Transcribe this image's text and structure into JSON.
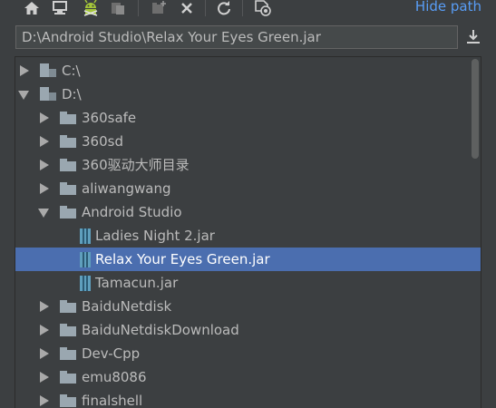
{
  "toolbar": {
    "buttons": [
      {
        "name": "home-icon"
      },
      {
        "name": "desktop-icon"
      },
      {
        "name": "android-module-icon"
      },
      {
        "name": "project-icon"
      },
      {
        "name": "new-folder-icon"
      },
      {
        "name": "delete-icon"
      },
      {
        "name": "refresh-icon"
      },
      {
        "name": "show-hidden-icon"
      }
    ],
    "hide_path_label": "Hide path"
  },
  "path_field": {
    "value": "D:\\Android Studio\\Relax Your Eyes Green.jar"
  },
  "tree": {
    "items": [
      {
        "label": "C:\\",
        "kind": "drive",
        "level": 0,
        "state": "collapsed"
      },
      {
        "label": "D:\\",
        "kind": "drive",
        "level": 0,
        "state": "expanded"
      },
      {
        "label": "360safe",
        "kind": "folder",
        "level": 1,
        "state": "collapsed"
      },
      {
        "label": "360sd",
        "kind": "folder",
        "level": 1,
        "state": "collapsed"
      },
      {
        "label": "360驱动大师目录",
        "kind": "folder",
        "level": 1,
        "state": "collapsed"
      },
      {
        "label": "aliwangwang",
        "kind": "folder",
        "level": 1,
        "state": "collapsed"
      },
      {
        "label": "Android Studio",
        "kind": "folder",
        "level": 1,
        "state": "expanded"
      },
      {
        "label": "Ladies Night 2.jar",
        "kind": "jar",
        "level": 2,
        "state": "leaf"
      },
      {
        "label": "Relax Your Eyes Green.jar",
        "kind": "jar",
        "level": 2,
        "state": "leaf",
        "selected": true
      },
      {
        "label": "Tamacun.jar",
        "kind": "jar",
        "level": 2,
        "state": "leaf"
      },
      {
        "label": "BaiduNetdisk",
        "kind": "folder",
        "level": 1,
        "state": "collapsed"
      },
      {
        "label": "BaiduNetdiskDownload",
        "kind": "folder",
        "level": 1,
        "state": "collapsed"
      },
      {
        "label": "Dev-Cpp",
        "kind": "folder",
        "level": 1,
        "state": "collapsed"
      },
      {
        "label": "emu8086",
        "kind": "folder",
        "level": 1,
        "state": "collapsed"
      },
      {
        "label": "finalshell",
        "kind": "folder",
        "level": 1,
        "state": "collapsed"
      }
    ]
  },
  "colors": {
    "background": "#3c3f41",
    "selection": "#4b6eaf",
    "link": "#589df6",
    "text": "#bbbbbb"
  }
}
